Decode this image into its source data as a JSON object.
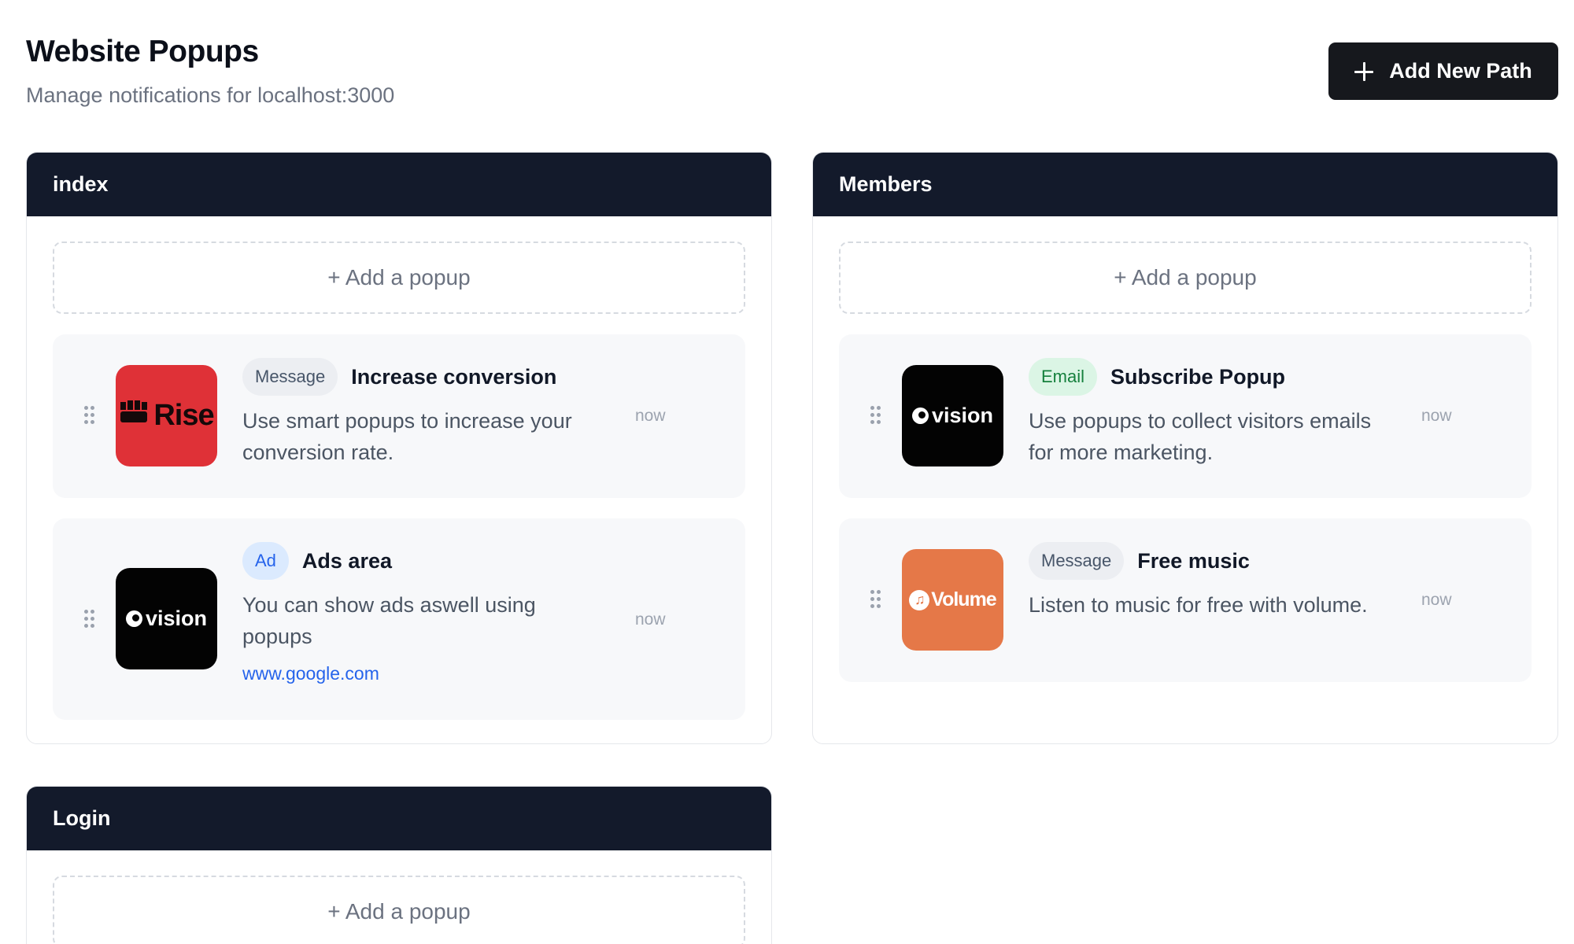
{
  "header": {
    "title": "Website Popups",
    "subtitle": "Manage notifications for localhost:3000"
  },
  "toolbar": {
    "add_path_label": "Add New Path"
  },
  "paths": [
    {
      "name": "index",
      "add_popup_label": "+ Add a popup",
      "popups": [
        {
          "logo_text": "Rise",
          "logo_icon": "fist-icon",
          "tag": "Message",
          "title": "Increase conversion",
          "description": "Use smart popups to increase your conversion rate.",
          "time": "now"
        },
        {
          "logo_text": "vision",
          "logo_icon": "eye-icon",
          "tag": "Ad",
          "title": "Ads area",
          "description": "You can show ads aswell using popups",
          "link": "www.google.com",
          "time": "now"
        }
      ]
    },
    {
      "name": "Members",
      "add_popup_label": "+ Add a popup",
      "popups": [
        {
          "logo_text": "vision",
          "logo_icon": "eye-icon",
          "tag": "Email",
          "title": "Subscribe Popup",
          "description": "Use popups to collect visitors emails for more marketing.",
          "time": "now"
        },
        {
          "logo_text": "Volume",
          "logo_icon": "music-note-icon",
          "tag": "Message",
          "title": "Free music",
          "description": "Listen to music for free with volume.",
          "time": "now"
        }
      ]
    },
    {
      "name": "Login",
      "add_popup_label": "+ Add a popup",
      "popups": []
    }
  ],
  "colors": {
    "path_header_bg": "#131a2b",
    "primary_button_bg": "#16181d",
    "rise_logo_bg": "#df3137",
    "vision_logo_bg": "#030303",
    "volume_logo_bg": "#e57848",
    "email_tag_bg": "#dbf5e5",
    "ad_tag_bg": "#dbeafe",
    "link": "#2563eb"
  }
}
